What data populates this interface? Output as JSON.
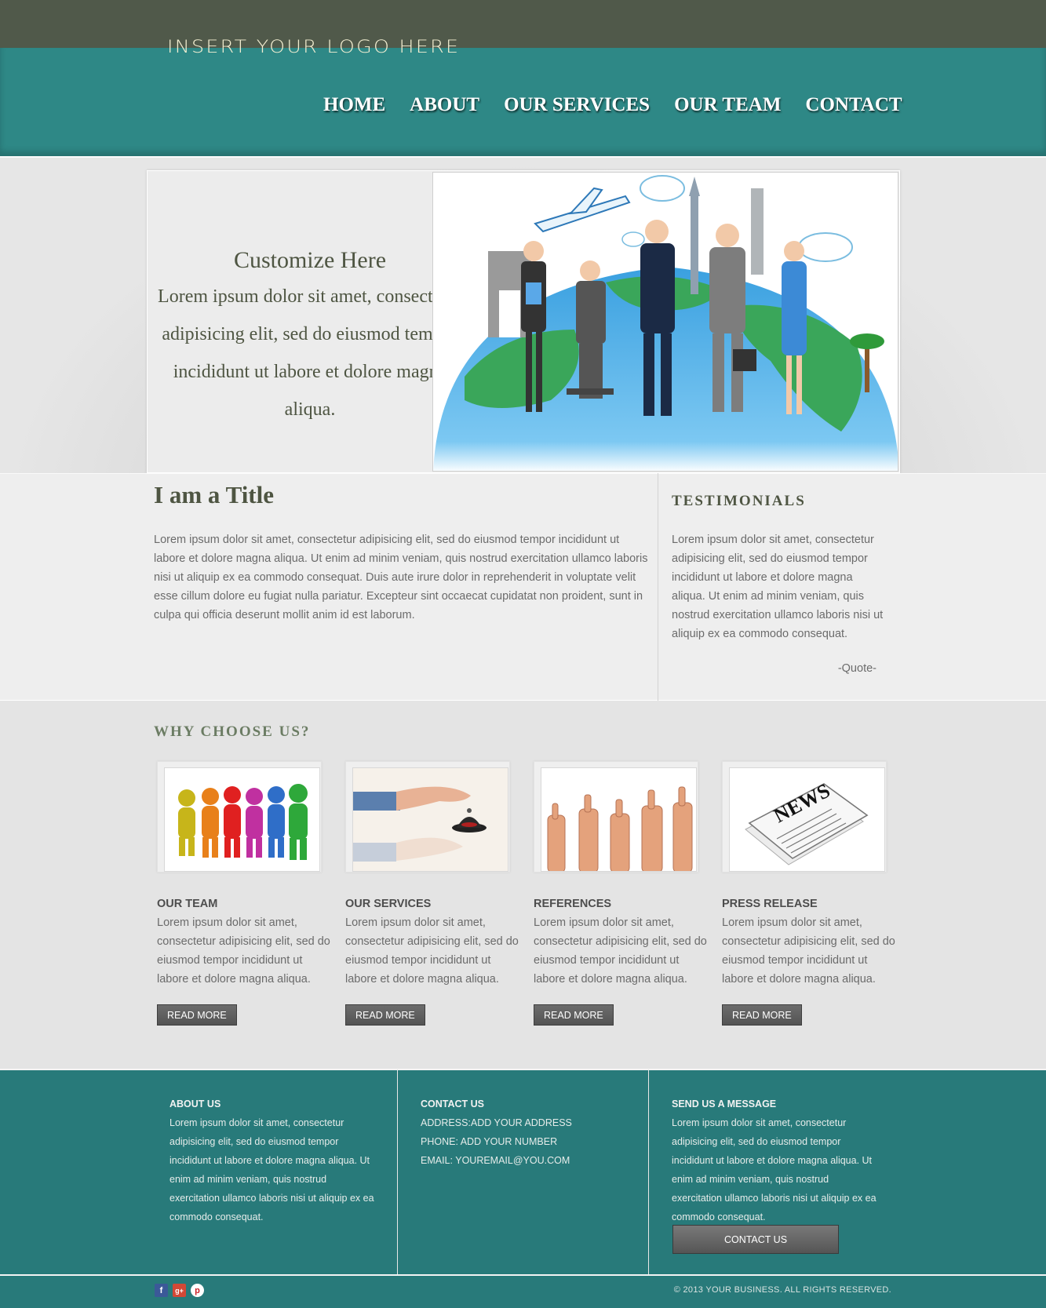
{
  "colors": {
    "topbar": "#50594a",
    "teal": "#2e8886",
    "footer": "#287a7a",
    "text_olive": "#4e5542",
    "body_gray": "#6b6b6b"
  },
  "header": {
    "logo": "INSERT YOUR LOGO HERE",
    "nav": [
      "HOME",
      "ABOUT",
      "OUR SERVICES",
      "OUR TEAM",
      "CONTACT"
    ]
  },
  "hero": {
    "title": "Customize Here",
    "body": "Lorem ipsum dolor sit amet, consectetur adipisicing elit, sed do eiusmod tempor incididunt ut labore et dolore magna aliqua."
  },
  "main": {
    "title": "I am a Title",
    "body": "Lorem ipsum dolor sit amet, consectetur adipisicing elit, sed do eiusmod tempor incididunt ut labore et dolore magna aliqua. Ut enim ad minim veniam, quis nostrud exercitation ullamco laboris nisi ut aliquip ex ea commodo consequat. Duis aute irure dolor in reprehenderit in voluptate velit esse cillum dolore eu fugiat nulla pariatur. Excepteur sint occaecat cupidatat non proident, sunt in culpa qui officia deserunt mollit anim id est laborum."
  },
  "testimonials": {
    "title": "TESTIMONIALS",
    "body": "Lorem ipsum dolor sit amet, consectetur adipisicing elit, sed do eiusmod tempor incididunt ut labore et dolore magna aliqua. Ut enim ad minim veniam, quis nostrud exercitation ullamco laboris nisi ut aliquip ex ea commodo consequat.",
    "quote": "-Quote-"
  },
  "why": {
    "title": "WHY CHOOSE US?",
    "features": [
      {
        "title": "OUR TEAM",
        "body": "Lorem ipsum dolor sit amet, consectetur adipisicing elit, sed do eiusmod tempor incididunt ut labore et dolore magna aliqua.",
        "button": "READ MORE",
        "icon": "team-figures-icon"
      },
      {
        "title": "OUR SERVICES",
        "body": "Lorem ipsum dolor sit amet, consectetur adipisicing elit, sed do eiusmod tempor incididunt ut labore et dolore magna aliqua.",
        "button": "READ MORE",
        "icon": "service-bell-icon"
      },
      {
        "title": "REFERENCES",
        "body": "Lorem ipsum dolor sit amet, consectetur adipisicing elit, sed do eiusmod tempor incididunt ut labore et dolore magna aliqua.",
        "button": "READ MORE",
        "icon": "thumbs-up-icon"
      },
      {
        "title": "PRESS RELEASE",
        "body": "Lorem ipsum dolor sit amet, consectetur adipisicing elit, sed do eiusmod tempor incididunt ut labore et dolore magna aliqua.",
        "button": "READ MORE",
        "icon": "newspaper-icon"
      }
    ]
  },
  "footer": {
    "about": {
      "heading": "ABOUT US",
      "body": "Lorem ipsum dolor sit amet, consectetur adipisicing elit, sed do eiusmod tempor incididunt ut labore et dolore magna aliqua. Ut enim ad minim veniam, quis nostrud exercitation ullamco laboris nisi ut aliquip ex ea commodo consequat."
    },
    "contact": {
      "heading": "CONTACT US",
      "address": "ADDRESS:ADD YOUR ADDRESS",
      "phone": "PHONE: ADD YOUR NUMBER",
      "email": "EMAIL: YOUREMAIL@YOU.COM"
    },
    "message": {
      "heading": "SEND US A MESSAGE",
      "body": "Lorem ipsum dolor sit amet, consectetur adipisicing elit, sed do eiusmod tempor incididunt ut labore et dolore magna aliqua. Ut enim ad minim veniam, quis nostrud exercitation ullamco laboris nisi ut aliquip ex ea commodo consequat.",
      "button": "CONTACT US"
    },
    "social": [
      "facebook-icon",
      "google-plus-icon",
      "pinterest-icon"
    ],
    "copyright": "© 2013 YOUR BUSINESS. ALL RIGHTS RESERVED."
  }
}
